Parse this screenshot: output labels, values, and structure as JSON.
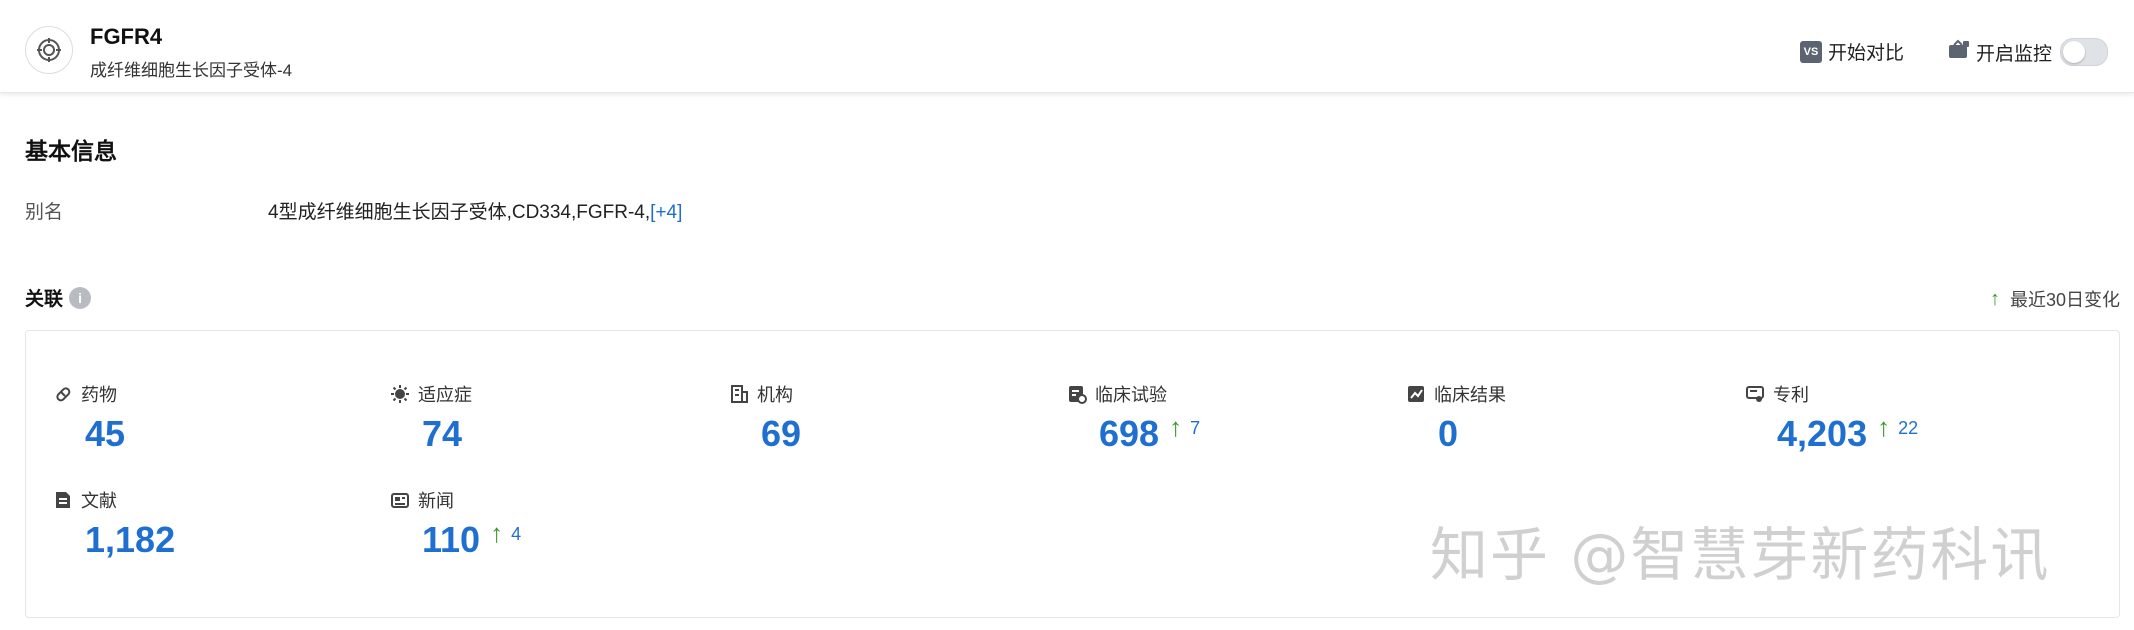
{
  "header": {
    "title": "FGFR4",
    "subtitle": "成纤维细胞生长因子受体-4",
    "compare_badge": "VS",
    "compare_label": "开始对比",
    "monitor_label": "开启监控",
    "monitor_on": false
  },
  "basic": {
    "title": "基本信息",
    "alias_label": "别名",
    "alias_value": "4型成纤维细胞生长因子受体,CD334,FGFR-4,",
    "alias_more": "[+4]"
  },
  "relations": {
    "title": "关联",
    "info_glyph": "i",
    "recent_arrow": "↑",
    "recent_label": "最近30日变化",
    "stats": [
      {
        "label": "药物",
        "value": "45",
        "icon": "pill-icon"
      },
      {
        "label": "适应症",
        "value": "74",
        "icon": "virus-icon"
      },
      {
        "label": "机构",
        "value": "69",
        "icon": "building-icon"
      },
      {
        "label": "临床试验",
        "value": "698",
        "delta": "7",
        "icon": "clinical-trial-icon"
      },
      {
        "label": "临床结果",
        "value": "0",
        "icon": "clinical-result-icon"
      },
      {
        "label": "专利",
        "value": "4,203",
        "delta": "22",
        "icon": "patent-icon"
      },
      {
        "label": "文献",
        "value": "1,182",
        "icon": "document-icon"
      },
      {
        "label": "新闻",
        "value": "110",
        "delta": "4",
        "icon": "news-icon"
      }
    ]
  },
  "watermark": "知乎 @智慧芽新药科讯",
  "colors": {
    "accent": "#1f6fd1",
    "up": "#3a9a28"
  }
}
